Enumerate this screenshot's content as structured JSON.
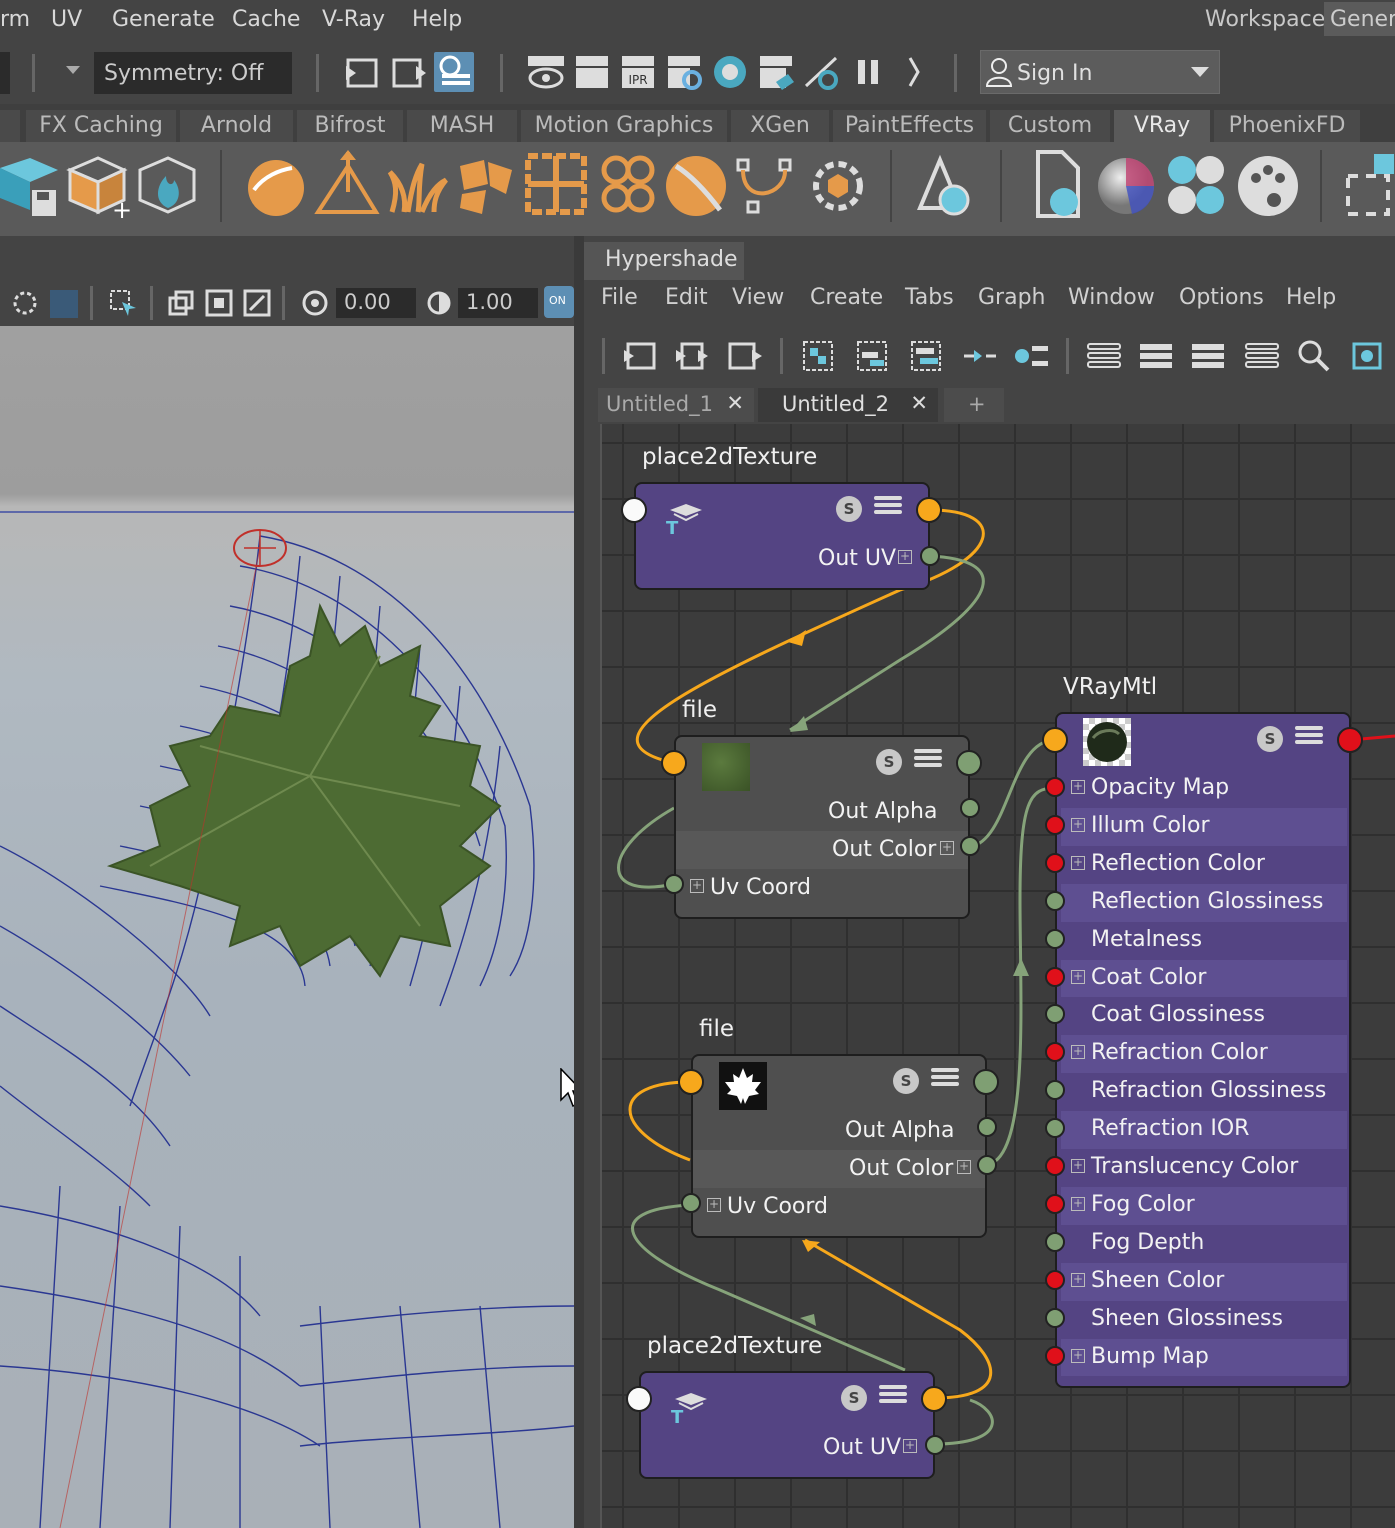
{
  "menubar": {
    "items": [
      "rm",
      "UV",
      "Generate",
      "Cache",
      "V-Ray",
      "Help"
    ],
    "workspace_label": "Workspace:",
    "workspace_value": "General"
  },
  "statusline": {
    "symmetry": "Symmetry: Off",
    "sign_in": "Sign In"
  },
  "shelf": {
    "tabs": [
      "FX Caching",
      "Arnold",
      "Bifrost",
      "MASH",
      "Motion Graphics",
      "XGen",
      "PaintEffects",
      "Custom",
      "VRay",
      "PhoenixFD"
    ],
    "active_tab": "VRay"
  },
  "viewport": {
    "field_a": "0.00",
    "field_b": "1.00",
    "toggle": "ON"
  },
  "hypershade": {
    "title": "Hypershade",
    "menu": [
      "File",
      "Edit",
      "View",
      "Create",
      "Tabs",
      "Graph",
      "Window",
      "Options",
      "Help"
    ],
    "tabs": [
      "Untitled_1",
      "Untitled_2"
    ],
    "active_tab": "Untitled_2",
    "add_tab": "+",
    "close_glyph": "✕"
  },
  "nodes": {
    "place2d_top": {
      "title": "place2dTexture",
      "out": "Out UV"
    },
    "file_top": {
      "title": "file",
      "out_alpha": "Out Alpha",
      "out_color": "Out Color",
      "uv": "Uv Coord"
    },
    "file_bottom": {
      "title": "file",
      "out_alpha": "Out Alpha",
      "out_color": "Out Color",
      "uv": "Uv Coord"
    },
    "place2d_bottom": {
      "title": "place2dTexture",
      "out": "Out UV"
    },
    "vraymtl": {
      "title": "VRayMtl",
      "attributes": [
        {
          "label": "Opacity Map",
          "port": "red",
          "expand": true
        },
        {
          "label": "Illum Color",
          "port": "red",
          "expand": true
        },
        {
          "label": "Reflection Color",
          "port": "red",
          "expand": true
        },
        {
          "label": "Reflection Glossiness",
          "port": "green",
          "expand": false
        },
        {
          "label": "Metalness",
          "port": "green",
          "expand": false
        },
        {
          "label": "Coat Color",
          "port": "red",
          "expand": true
        },
        {
          "label": "Coat Glossiness",
          "port": "green",
          "expand": false
        },
        {
          "label": "Refraction Color",
          "port": "red",
          "expand": true
        },
        {
          "label": "Refraction Glossiness",
          "port": "green",
          "expand": false
        },
        {
          "label": "Refraction IOR",
          "port": "green",
          "expand": false
        },
        {
          "label": "Translucency Color",
          "port": "red",
          "expand": true
        },
        {
          "label": "Fog Color",
          "port": "red",
          "expand": true
        },
        {
          "label": "Fog Depth",
          "port": "green",
          "expand": false
        },
        {
          "label": "Sheen Color",
          "port": "red",
          "expand": true
        },
        {
          "label": "Sheen Glossiness",
          "port": "green",
          "expand": false
        },
        {
          "label": "Bump Map",
          "port": "red",
          "expand": true
        }
      ]
    },
    "s_glyph": "S"
  },
  "colors": {
    "node_purple": "#544483",
    "node_gray": "#4f4f4f",
    "port_orange": "#f7a81c",
    "port_green": "#7f9f73",
    "port_red": "#e0101a",
    "wire_orange": "#f7a81c",
    "wire_green": "#86a37a",
    "accent_blue": "#5d8fb4"
  }
}
